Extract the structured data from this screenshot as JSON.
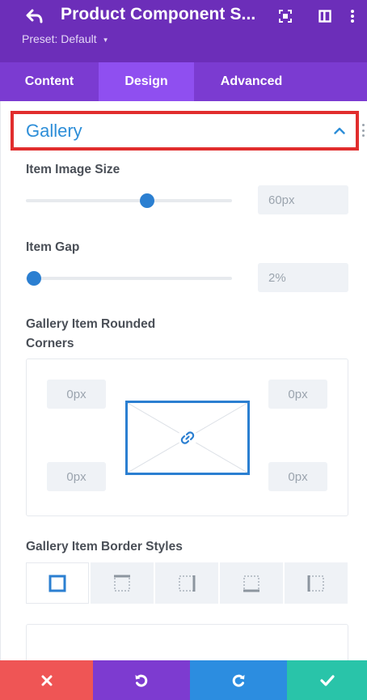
{
  "header": {
    "title": "Product Component S...",
    "preset": "Preset: Default"
  },
  "tabs": [
    {
      "label": "Content"
    },
    {
      "label": "Design"
    },
    {
      "label": "Advanced"
    }
  ],
  "section": {
    "title": "Gallery"
  },
  "fields": {
    "image_size": {
      "label": "Item Image Size",
      "value": "60px",
      "level": 0.59
    },
    "gap": {
      "label": "Item Gap",
      "value": "2%",
      "level": 0.0
    },
    "rounded": {
      "label_line1": "Gallery Item Rounded",
      "label_line2": "Corners",
      "top_left": "0px",
      "top_right": "0px",
      "bottom_left": "0px",
      "bottom_right": "0px"
    },
    "border_styles": {
      "label": "Gallery Item Border Styles",
      "options": [
        "all-sides",
        "top",
        "right",
        "bottom",
        "left"
      ]
    }
  },
  "footer": {
    "buttons": [
      "close",
      "undo",
      "redo",
      "save"
    ]
  },
  "colors": {
    "header_bg": "#6c2eb9",
    "tab_bg": "#7b3bd1",
    "tab_active": "#8f4ff0",
    "accent": "#2b7fd1",
    "highlight_border": "#e12d2d",
    "close": "#ef5555",
    "undo": "#7d3bd0",
    "redo": "#2c8de0",
    "save": "#29c4a9"
  },
  "icons": [
    "back-arrow-icon",
    "focus-icon",
    "split-view-icon",
    "more-vertical-icon",
    "chevron-up-icon",
    "link-icon",
    "close-icon",
    "undo-icon",
    "redo-icon",
    "check-icon"
  ]
}
